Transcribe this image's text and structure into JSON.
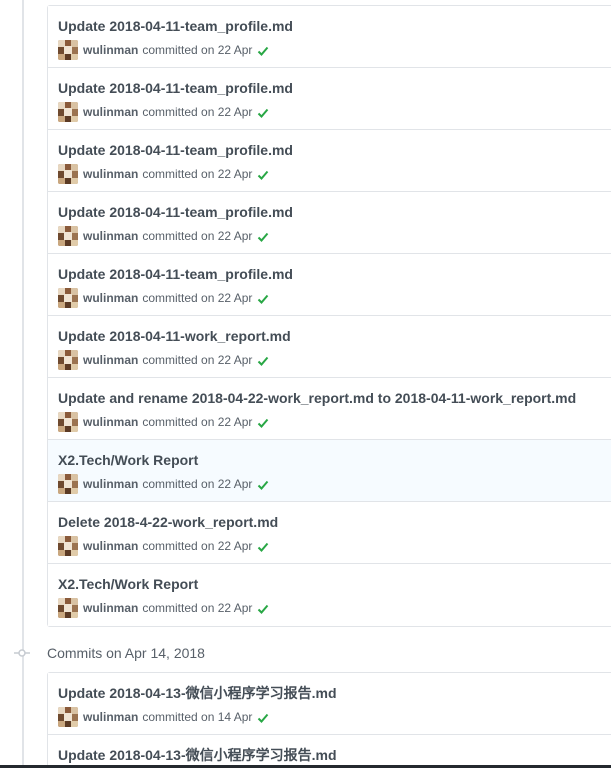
{
  "groups": [
    {
      "commits": [
        {
          "title": "Update 2018-04-11-team_profile.md",
          "author": "wulinman",
          "meta": "committed on 22 Apr",
          "status": "success-check-icon"
        },
        {
          "title": "Update 2018-04-11-team_profile.md",
          "author": "wulinman",
          "meta": "committed on 22 Apr",
          "status": "success-check-icon"
        },
        {
          "title": "Update 2018-04-11-team_profile.md",
          "author": "wulinman",
          "meta": "committed on 22 Apr",
          "status": "success-check-icon"
        },
        {
          "title": "Update 2018-04-11-team_profile.md",
          "author": "wulinman",
          "meta": "committed on 22 Apr",
          "status": "success-check-icon"
        },
        {
          "title": "Update 2018-04-11-team_profile.md",
          "author": "wulinman",
          "meta": "committed on 22 Apr",
          "status": "success-check-icon"
        },
        {
          "title": "Update 2018-04-11-work_report.md",
          "author": "wulinman",
          "meta": "committed on 22 Apr",
          "status": "success-check-icon"
        },
        {
          "title": "Update and rename 2018-04-22-work_report.md to 2018-04-11-work_report.md",
          "author": "wulinman",
          "meta": "committed on 22 Apr",
          "status": "success-check-icon"
        },
        {
          "title": "X2.Tech/Work Report",
          "author": "wulinman",
          "meta": "committed on 22 Apr",
          "status": "success-check-icon",
          "highlighted": true
        },
        {
          "title": "Delete 2018-4-22-work_report.md",
          "author": "wulinman",
          "meta": "committed on 22 Apr",
          "status": "success-check-icon"
        },
        {
          "title": "X2.Tech/Work Report",
          "author": "wulinman",
          "meta": "committed on 22 Apr",
          "status": "success-check-icon"
        }
      ]
    },
    {
      "heading": "Commits on Apr 14, 2018",
      "commits": [
        {
          "title": "Update 2018-04-13-微信小程序学习报告.md",
          "author": "wulinman",
          "meta": "committed on 14 Apr",
          "status": "success-check-icon"
        },
        {
          "title": "Update 2018-04-13-微信小程序学习报告.md",
          "author": "",
          "meta": "",
          "status": ""
        }
      ]
    }
  ],
  "colors": {
    "title": "#444d56",
    "meta": "#586069",
    "success": "#28a745",
    "border": "#e1e4e8",
    "highlight_bg": "#f6fbff"
  }
}
